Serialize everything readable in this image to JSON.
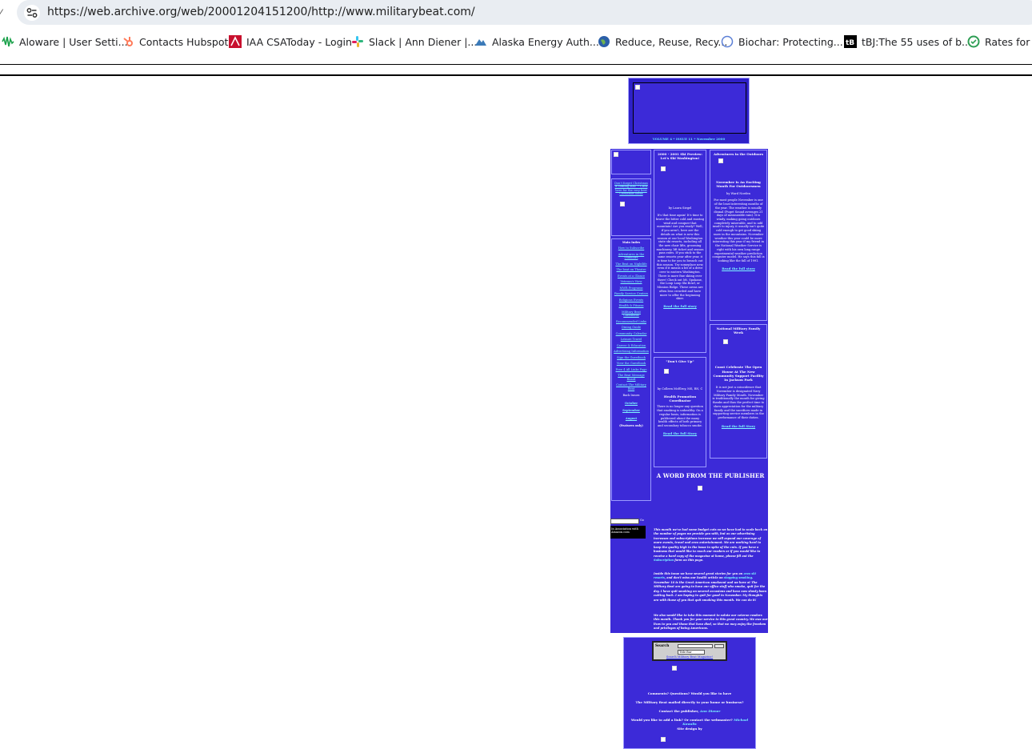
{
  "browser": {
    "url": "https://web.archive.org/web/20001204151200/http://www.militarybeat.com/",
    "bookmarks": [
      {
        "label": "Aloware | User Setti...",
        "icon": "aloware-wave-icon",
        "color": "#1aa14a"
      },
      {
        "label": "Contacts Hubspot",
        "icon": "hubspot-icon",
        "color": "#ff7a59"
      },
      {
        "label": "IAA CSAToday - Login",
        "icon": "iaa-icon",
        "color": "#c8102e"
      },
      {
        "label": "Slack | Ann Diener |...",
        "icon": "slack-icon",
        "color": "#4a154b"
      },
      {
        "label": "Alaska Energy Auth...",
        "icon": "mountain-icon",
        "color": "#3b7ab8"
      },
      {
        "label": "Reduce, Reuse, Recy...",
        "icon": "globe-icon",
        "color": "#2b5fa8"
      },
      {
        "label": "Biochar: Protecting...",
        "icon": "circle-icon",
        "color": "#5b7fd6"
      },
      {
        "label": "tBJ:The 55 uses of b...",
        "icon": "tbj-icon",
        "color": "#000000"
      },
      {
        "label": "Rates for A",
        "icon": "rates-icon",
        "color": "#2e9e54"
      }
    ]
  },
  "page": {
    "header_caption": "VOLUME 4 * ISSUE 11 * November 2000",
    "side": {
      "promo": "Don't forget Christmas is coming fast! -- Click here for the very best Christmas ideas",
      "main_index_label": "Main Index",
      "nav": [
        "How to Subscribe",
        "Adventures in the Outdoors",
        "The Beat on Nightlife",
        "The beat on Theatre",
        "Events at a Glance",
        "Veteran's View",
        "MWR Programs",
        "Family Service Centers",
        "Religious Events",
        "Health & Fitness",
        "Military Beat Classifieds",
        "Recommended Links",
        "Dining Guide",
        "Community Calendar",
        "Leisure Travel",
        "Career & Education",
        "Advertising Information",
        "Sign the Guestbook",
        "View the Guestbook",
        "Free 4 All Links Page",
        "The Beat Message Board",
        "Contact The Military Beat"
      ],
      "back_issues_label": "Back Issues",
      "back_issues": [
        "October",
        "September",
        "August"
      ],
      "features_note": "(Features only)",
      "amazon_text": "In Association with Amazon.com",
      "go_label": "Go"
    },
    "story1": {
      "title": "2000 - 2001 Ski Preview: Let's Ski Washington!",
      "byline": "by Laura Siegel",
      "body": "It's that time again! It's time to brave the bitter cold and roaring wind and conquer that mountain! Are you ready?  Well, if you aren't, here are the details on what is new this season at our local Washington state ski resorts, including all the new chair lifts, grooming machinery, lift ticket and season pass rates. If you stick to the same resorts year after year, it is time to for you to branch out this season. Try someplace new, even if it means a bit of a drive over to eastern Washington. There is more fine skiing over there! Check out Mt. Spokane, the Loup Loup Ski Bowl, or Mission Ridge. These areas are often less crowded and have more to offer the beginning skier.",
      "read_more": "Read the full story"
    },
    "story2": {
      "title": "\"Don't Give Up\"",
      "byline": "by Colleen McElroy, MS, RN, C",
      "role": "Health Promotion Coordinator",
      "body": "There is no longer any question that smoking is unhealthy. On a regular basis, information is publicized about the many health effects of both primary and secondary tobacco smoke.",
      "read_more": "Read the full Story"
    },
    "story3": {
      "section": "Adventures in the Outdoors",
      "title": "November Is An Exciting Month For Outdoorsmen",
      "byline": "by Ward Norden",
      "body": "For most people November is one of the least interesting months of the year. The weather is usually dismal (Puget Sound averages 21 days of measurable rain). It is windy, making going outdoors completely miserable, and to add insult to injury, it usually isn't quite cold enough to get good skiing snow in the mountains.  November weather this year could be more interesting this year if my friend in the National Weather Service is right with his own long range experimental weather prediction computer model. He says this fall is looking like the fall of 1991.",
      "read_more": "Read the full story"
    },
    "story4": {
      "section": "National Military Family Week",
      "title": "Coast Celebrate The Open House At The New Community Support Facility In Jackson Park",
      "body": "It is not just a coincidence that November is designated Navy Military Family Month. November is traditionally the month for giving thanks and thus the perfect time to show appreciation for the military family and the sacrifices made in supporting service members in the performance of their duties.",
      "read_more": "Read the full Story"
    },
    "publisher": {
      "heading": "A WORD FROM THE PUBLISHER",
      "p1": "This month we've had some budget cuts so we have had to scale back on the number of pages we provide you with, but as our advertising increases and subscriptions increase we will expand our coverage of more events, travel and area entertainment. We are working hard to keep the quality high in the issue in spite of the cuts. If you have a business that would like to reach our readers or if you would like to receive a hard copy of the magazine at home, please fill out the",
      "p1_link": "Subscription",
      "p1_end": "form on this page.",
      "p2": "Inside this issue we have several great stories for you on",
      "p2_link1": "area ski resorts",
      "p2_mid": ", and don't miss our health article on",
      "p2_link2": "stopping smoking",
      "p2_end": ". November 16 is the Great American smokeout and we here at The Military Beat are going to have our office staff who smoke, quit for the day. I have quit smoking on several occasions and have now slowly been cutting back. I am hoping to quit for good in November. My thoughts are with those of you that quit smoking this month. We can do it!",
      "p3": "We also would like to take this moment to salute our veteran readers this month. Thank you for your service to this great country. We owe our lives to you and those that have died, so that we may enjoy the freedom and privileges of being Americans."
    },
    "footer": {
      "search_label": "Search",
      "search_select": "Title Bar",
      "search_link": "Search Military Beat Magazine!",
      "go": "Go",
      "line1": "Comments? Questions? Would you like to have",
      "line2": "The Military Beat mailed directly to your home or business?",
      "line3": "Contact the publisher,",
      "line3_link": "Ann Diener",
      "line4": "Would you like to add a link? Or contact the webmaster?",
      "line4_link": "Michael Kowalis",
      "line5": "Site design by"
    }
  }
}
